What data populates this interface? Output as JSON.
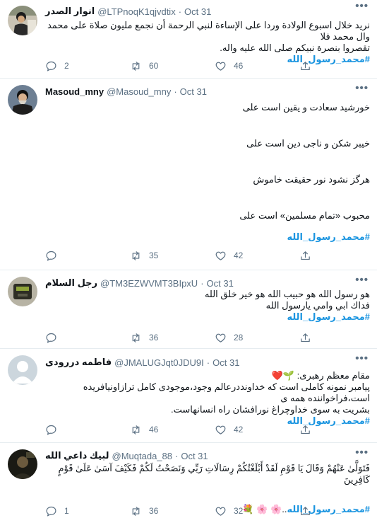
{
  "more_label": "•••",
  "tweets": [
    {
      "display_name": "انوار الصدر",
      "handle": "@LTPnoqK1qjvdtix",
      "time": "Oct 31",
      "lines": [
        "نريد خلال اسبوع الولادة وردا على الإساءة لنبي الرحمة أن نجمع مليون صلاة على محمد وال محمد فلا",
        "تقصروا بنصرة نبيكم صلى الله عليه واله."
      ],
      "hashtag": "#محمد_رسول_الله",
      "reply_count": "2",
      "retweet_count": "60",
      "like_count": "46",
      "avatar": "avatar-cleric"
    },
    {
      "display_name": "Masoud_mny",
      "handle": "@Masoud_mny",
      "time": "Oct 31",
      "lines": [
        "خورشید سعادت و یقین است علی",
        "خیبر شکن و ناجی دین است علی",
        "هرگز نشود نور حقیقت خاموش",
        "محبوب «تمام مسلمین» است علی"
      ],
      "hashtag": "#محمد_رسول_الله",
      "reply_count": "",
      "retweet_count": "35",
      "like_count": "42",
      "avatar": "avatar-leader"
    },
    {
      "display_name": "رجل السلام",
      "handle": "@TM3EZWVMT3BIpxU",
      "time": "Oct 31",
      "lines": [
        "هو رسول الله هو حبيب الله هو خير خلق الله",
        "فداك ابي وامي يارسول الله"
      ],
      "hashtag": "#محمد_رسول_الله",
      "reply_count": "",
      "retweet_count": "36",
      "like_count": "28",
      "avatar": "avatar-object"
    },
    {
      "display_name": "فاطمه دررودی",
      "handle": "@JMALUGJqt0JDU9I",
      "time": "Oct 31",
      "lines": [
        "مقام معظم رهبری: 🌱❤️",
        "پیامبر نمونه کاملی است که خداونددرعالم وجود،موجودی کامل ترازاونیافریده است،فراخواننده همه ی",
        "بشریت به سوی خداوچراغ نورافشان راه انسانهاست."
      ],
      "hashtag": "#محمد_رسول_الله",
      "reply_count": "",
      "retweet_count": "46",
      "like_count": "42",
      "avatar": "avatar-default"
    },
    {
      "display_name": "لبیك داعي الله",
      "handle": "@Muqtada_88",
      "time": "Oct 31",
      "lines": [
        "فَتَوَلَّىٰ عَنْهُمْ وَقَالَ يَا قَوْمِ لَقَدْ أَبْلَغْتُكُمْ رِسَالَاتِ رَبِّي وَنَصَحْتُ لَكُمْ فَكَيْفَ آسَىٰ عَلَىٰ قَوْمٍ كَافِرِينَ"
      ],
      "hashtag": "#محمد_رسول_الله",
      "hashtag_suffix": "..🌸 🌸 💐",
      "reply_count": "1",
      "retweet_count": "36",
      "like_count": "32",
      "avatar": "avatar-man"
    }
  ]
}
